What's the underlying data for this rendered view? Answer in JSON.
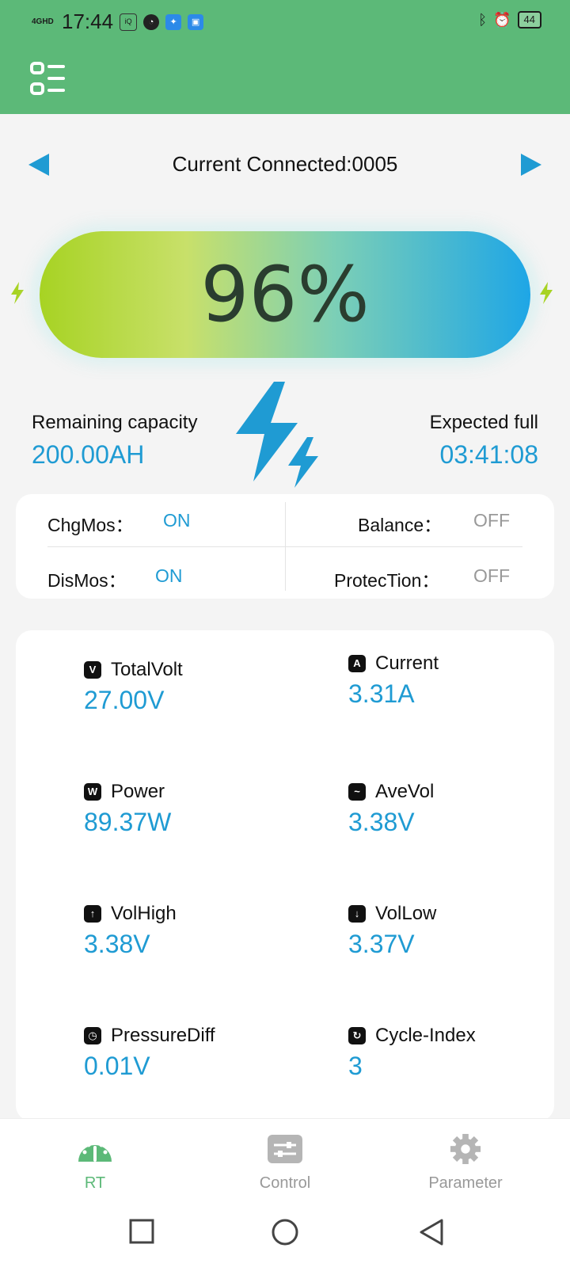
{
  "status_bar": {
    "network": "4GHD",
    "time": "17:44",
    "battery": "44"
  },
  "header": {
    "connected_label": "Current Connected:0005"
  },
  "battery": {
    "percent_text": "96%",
    "level_percent": 96
  },
  "capacity": {
    "remaining_label": "Remaining capacity",
    "remaining_value": "200.00AH",
    "expected_label": "Expected full",
    "expected_value": "03:41:08"
  },
  "mos": {
    "chg_label": "ChgMos：",
    "chg_value": "ON",
    "balance_label": "Balance：",
    "balance_value": "OFF",
    "dis_label": "DisMos：",
    "dis_value": "ON",
    "protection_label": "ProtecTion：",
    "protection_value": "OFF"
  },
  "metrics": [
    {
      "label": "TotalVolt",
      "value": "27.00V",
      "icon": "voltage-icon"
    },
    {
      "label": "Current",
      "value": "3.31A",
      "icon": "current-icon"
    },
    {
      "label": "Power",
      "value": "89.37W",
      "icon": "power-icon"
    },
    {
      "label": "AveVol",
      "value": "3.38V",
      "icon": "average-voltage-icon"
    },
    {
      "label": "VolHigh",
      "value": "3.38V",
      "icon": "voltage-high-icon"
    },
    {
      "label": "VolLow",
      "value": "3.37V",
      "icon": "voltage-low-icon"
    },
    {
      "label": "PressureDiff",
      "value": "0.01V",
      "icon": "pressure-diff-icon"
    },
    {
      "label": "Cycle-Index",
      "value": "3",
      "icon": "cycle-index-icon"
    }
  ],
  "tabs": [
    {
      "label": "RT",
      "icon": "gauge-icon"
    },
    {
      "label": "Control",
      "icon": "sliders-icon"
    },
    {
      "label": "Parameter",
      "icon": "gear-icon"
    }
  ],
  "colors": {
    "accent_green": "#5cb978",
    "value_blue": "#1f9bd3"
  }
}
